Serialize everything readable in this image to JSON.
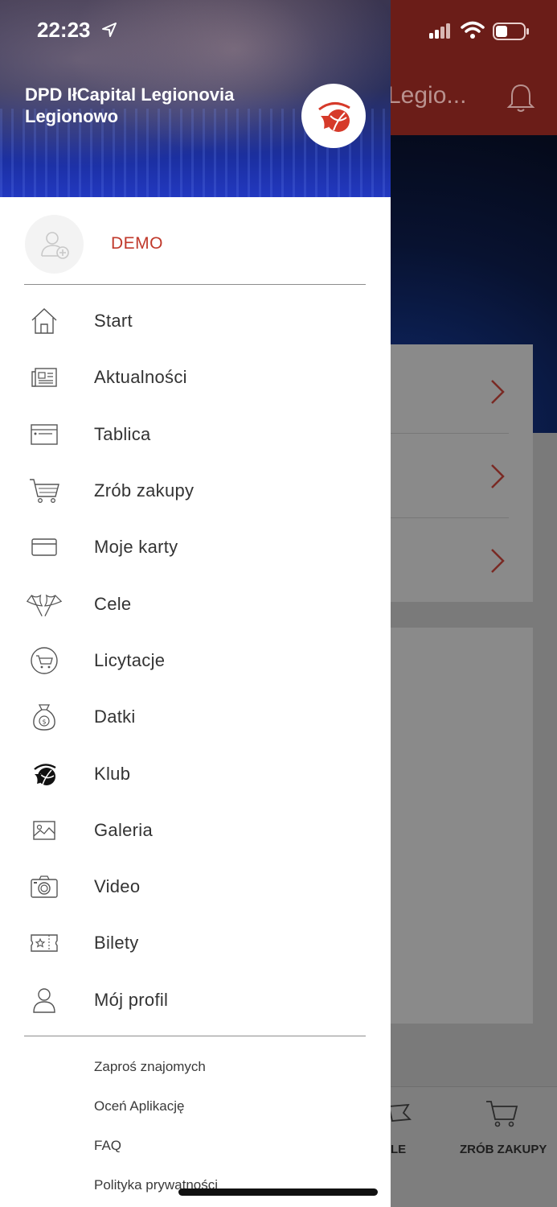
{
  "status_bar": {
    "time": "22:23"
  },
  "drawer": {
    "club_name": "DPD IłCapital Legionovia Legionowo",
    "profile": {
      "name": "DEMO"
    },
    "menu_items": [
      {
        "label": "Start",
        "icon": "home-icon"
      },
      {
        "label": "Aktualności",
        "icon": "newspaper-icon"
      },
      {
        "label": "Tablica",
        "icon": "board-icon"
      },
      {
        "label": "Zrób zakupy",
        "icon": "cart-icon"
      },
      {
        "label": "Moje karty",
        "icon": "card-icon"
      },
      {
        "label": "Cele",
        "icon": "flags-icon"
      },
      {
        "label": "Licytacje",
        "icon": "auction-cart-icon"
      },
      {
        "label": "Datki",
        "icon": "money-bag-icon"
      },
      {
        "label": "Klub",
        "icon": "club-logo-icon"
      },
      {
        "label": "Galeria",
        "icon": "image-icon"
      },
      {
        "label": "Video",
        "icon": "camera-icon"
      },
      {
        "label": "Bilety",
        "icon": "ticket-icon"
      },
      {
        "label": "Mój profil",
        "icon": "user-icon"
      }
    ],
    "secondary_items": [
      {
        "label": "Zaproś znajomych"
      },
      {
        "label": "Oceń Aplikację"
      },
      {
        "label": "FAQ"
      },
      {
        "label": "Polityka prywatności"
      }
    ]
  },
  "background_app": {
    "header_title": "Legio...",
    "tabs": [
      {
        "label": "LE"
      },
      {
        "label": "ZRÓB ZAKUPY"
      }
    ]
  },
  "colors": {
    "accent_red": "#c0392b",
    "header_dark_red": "#6b1d18"
  }
}
